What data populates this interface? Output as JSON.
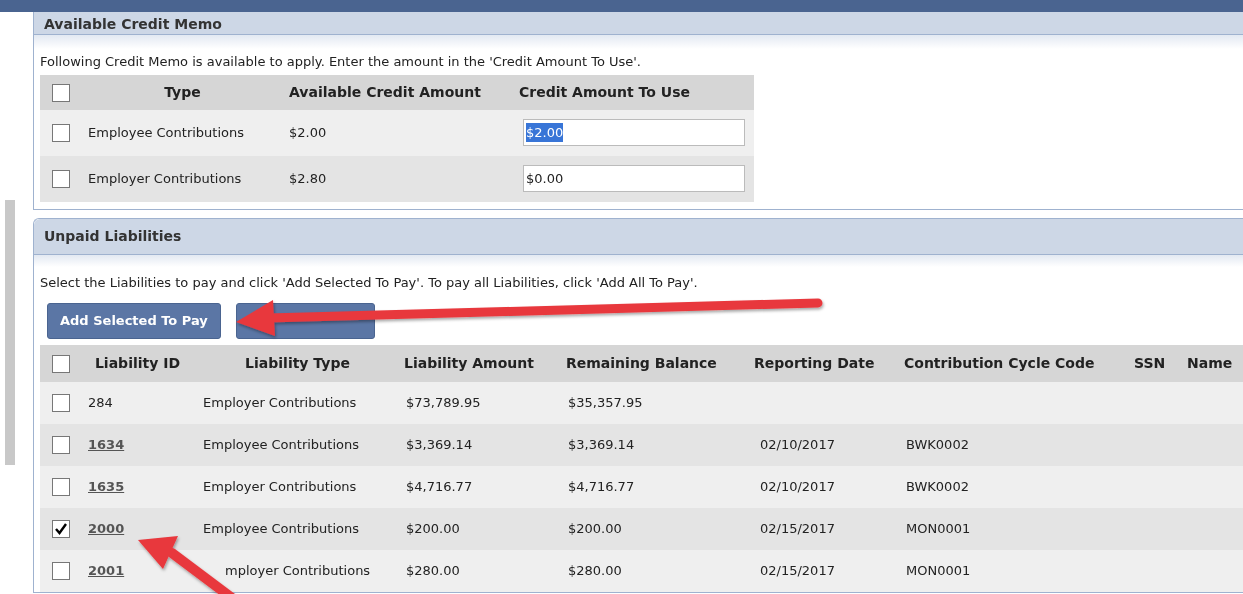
{
  "credit_memo": {
    "title": "Available Credit Memo",
    "instruction": "Following Credit Memo is available to apply. Enter the amount in the 'Credit Amount To Use'.",
    "header_checked": false,
    "columns": [
      "Type",
      "Available Credit Amount",
      "Credit Amount To Use"
    ],
    "rows": [
      {
        "checked": false,
        "type": "Employee Contributions",
        "available": "$2.00",
        "to_use": "$2.00",
        "text_selected": true
      },
      {
        "checked": false,
        "type": "Employer Contributions",
        "available": "$2.80",
        "to_use": "$0.00",
        "text_selected": false
      }
    ]
  },
  "unpaid_liabilities": {
    "title": "Unpaid Liabilities",
    "instruction": "Select the Liabilities to pay and click 'Add Selected To Pay'. To pay all Liabilities, click 'Add All To Pay'.",
    "buttons": [
      {
        "kind": "labeled",
        "label": "Add Selected To Pay"
      },
      {
        "kind": "covered"
      }
    ],
    "header_checked": false,
    "columns": [
      "Liability ID",
      "Liability Type",
      "Liability Amount",
      "Remaining Balance",
      "Reporting Date",
      "Contribution Cycle Code",
      "SSN",
      "Name"
    ],
    "rows": [
      {
        "checked": false,
        "id": "284",
        "id_is_link": false,
        "type": "Employer Contributions",
        "amount": "$73,789.95",
        "remaining": "$35,357.95"
      },
      {
        "checked": false,
        "id": "1634",
        "id_is_link": true,
        "type": "Employee Contributions",
        "amount": "$3,369.14",
        "remaining": "$3,369.14",
        "date": "02/10/2017",
        "cycle": "BWK0002"
      },
      {
        "checked": false,
        "id": "1635",
        "id_is_link": true,
        "type": "Employer Contributions",
        "amount": "$4,716.77",
        "remaining": "$4,716.77",
        "date": "02/10/2017",
        "cycle": "BWK0002"
      },
      {
        "checked": true,
        "id": "2000",
        "id_is_link": true,
        "type": "Employee Contributions",
        "amount": "$200.00",
        "remaining": "$200.00",
        "date": "02/15/2017",
        "cycle": "MON0001"
      },
      {
        "checked": false,
        "id": "2001",
        "id_is_link": true,
        "type": "mployer Contributions",
        "type_partly_hidden": true,
        "amount": "$280.00",
        "remaining": "$280.00",
        "date": "02/15/2017",
        "cycle": "MON0001"
      }
    ]
  }
}
